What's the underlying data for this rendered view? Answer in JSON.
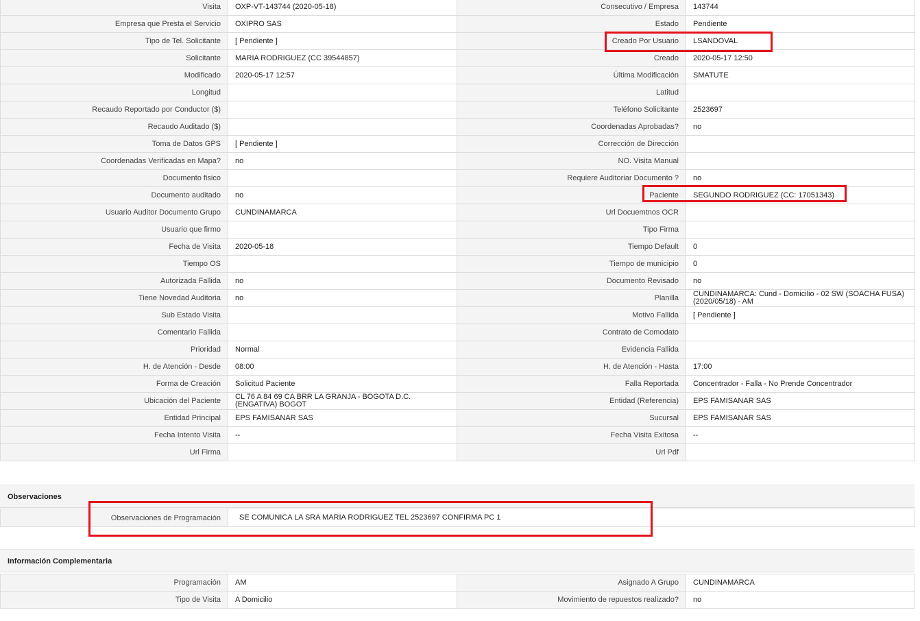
{
  "main_rows": [
    {
      "l1": "Visita",
      "v1": "OXP-VT-143744 (2020-05-18)",
      "l2": "Consecutivo / Empresa",
      "v2": "143744"
    },
    {
      "l1": "Empresa que Presta el Servicio",
      "v1": "OXIPRO SAS",
      "l2": "Estado",
      "v2": "Pendiente"
    },
    {
      "l1": "Tipo de Tel. Solicitante",
      "v1": "[ Pendiente ]",
      "l2": "Creado Por Usuario",
      "v2": "LSANDOVAL"
    },
    {
      "l1": "Solicitante",
      "v1": "MARIA RODRIGUEZ (CC 39544857)",
      "l2": "Creado",
      "v2": "2020-05-17 12:50"
    },
    {
      "l1": "Modificado",
      "v1": "2020-05-17 12:57",
      "l2": "Última Modificación",
      "v2": " SMATUTE"
    },
    {
      "l1": "Longitud",
      "v1": "",
      "l2": "Latitud",
      "v2": ""
    },
    {
      "l1": "Recaudo Reportado por Conductor ($)",
      "v1": "",
      "l2": "Teléfono Solicitante",
      "v2": "2523697"
    },
    {
      "l1": "Recaudo Auditado ($)",
      "v1": "",
      "l2": "Coordenadas Aprobadas?",
      "v2": " no"
    },
    {
      "l1": "Toma de Datos GPS",
      "v1": "[ Pendiente ]",
      "l2": "Corrección de Dirección",
      "v2": ""
    },
    {
      "l1": "Coordenadas Verificadas en Mapa?",
      "v1": " no",
      "l2": "NO. Visita Manual",
      "v2": ""
    },
    {
      "l1": "Documento fisico",
      "v1": "",
      "l2": "Requiere Auditoriar Documento ?",
      "v2": " no"
    },
    {
      "l1": "Documento auditado",
      "v1": " no",
      "l2": "Paciente",
      "v2": "SEGUNDO RODRIGUEZ (CC: 17051343)"
    },
    {
      "l1": "Usuario Auditor Documento Grupo",
      "v1": "CUNDINAMARCA",
      "l2": "Url Docuemtnos OCR",
      "v2": ""
    },
    {
      "l1": "Usuario que firmo",
      "v1": "",
      "l2": "Tipo Firma",
      "v2": ""
    },
    {
      "l1": "Fecha de Visita",
      "v1": " 2020-05-18",
      "l2": "Tiempo Default",
      "v2": "0"
    },
    {
      "l1": "Tiempo OS",
      "v1": "",
      "l2": "Tiempo de municipio",
      "v2": "0"
    },
    {
      "l1": "Autorizada Fallida",
      "v1": " no",
      "l2": "Documento Revisado",
      "v2": " no"
    },
    {
      "l1": "Tiene Novedad Auditoria",
      "v1": " no",
      "l2": "Planilla",
      "v2": "CUNDINAMARCA: Cund - Domicilio - 02 SW (SOACHA FUSA) (2020/05/18) - AM"
    },
    {
      "l1": "Sub Estado Visita",
      "v1": "",
      "l2": "Motivo Fallida",
      "v2": "[ Pendiente ]"
    },
    {
      "l1": "Comentario Fallida",
      "v1": "",
      "l2": "Contrato de Comodato",
      "v2": ""
    },
    {
      "l1": "Prioridad",
      "v1": "Normal",
      "l2": "Evidencia Fallida",
      "v2": ""
    },
    {
      "l1": "H. de Atención - Desde",
      "v1": "08:00",
      "l2": "H. de Atención - Hasta",
      "v2": "17:00"
    },
    {
      "l1": "Forma de Creación",
      "v1": "Solicitud Paciente",
      "l2": "Falla Reportada",
      "v2": "Concentrador - Falla - No Prende Concentrador"
    },
    {
      "l1": "Ubicación del Paciente",
      "v1": "CL 76 A 84 69 CA BRR LA GRANJA - BOGOTA D.C. (ENGATIVA) BOGOT",
      "l2": "Entidad (Referencia)",
      "v2": "EPS FAMISANAR SAS"
    },
    {
      "l1": "Entidad Principal",
      "v1": "EPS FAMISANAR SAS",
      "l2": "Sucursal",
      "v2": "EPS FAMISANAR SAS"
    },
    {
      "l1": "Fecha Intento Visita",
      "v1": " --",
      "l2": "Fecha Visita Exitosa",
      "v2": " --"
    },
    {
      "l1": "Url Firma",
      "v1": "",
      "l2": "Url Pdf",
      "v2": ""
    }
  ],
  "observaciones": {
    "title": "Observaciones",
    "label": "Observaciones de Programación",
    "value": "SE COMUNICA LA SRA MARIA RODRIGUEZ TEL 2523697 CONFIRMA PC 1"
  },
  "info_complementaria": {
    "title": "Información Complementaria",
    "rows": [
      {
        "l1": "Programación",
        "v1": "AM",
        "l2": "Asignado A Grupo",
        "v2": "CUNDINAMARCA"
      },
      {
        "l1": "Tipo de Visita",
        "v1": "A Domicilio",
        "l2": "Movimiento de repuestos realizado?",
        "v2": " no"
      }
    ]
  },
  "colors": {
    "highlight": "#e3121b",
    "label_bg": "#f4f4f4",
    "border": "#dcdcdc"
  }
}
